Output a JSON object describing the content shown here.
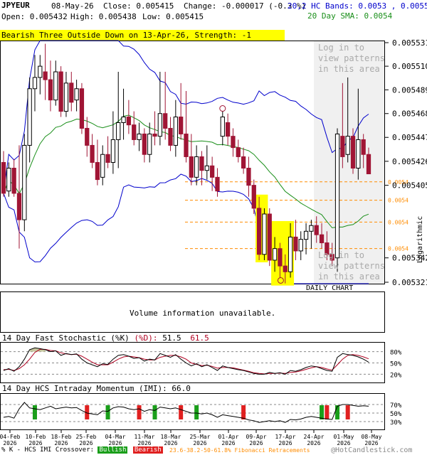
{
  "header": {
    "symbol": "JPYEUR",
    "date": "08-May-26",
    "close": "Close: 0.005415",
    "change": "Change: -0.000017 (-0.3 %)",
    "open": "Open: 0.005432",
    "high": "High: 0.005438",
    "low": "Low: 0.005415",
    "bands": "20,2 HC Bands: 0.0053 , 0.0055",
    "sma": "20 Day SMA: 0.0054",
    "pattern": "Bearish Three Outside Down on 13-Apr-26, Strength: -1"
  },
  "login_text": {
    "top_1": "Log in to",
    "top_2": "view patterns",
    "top_3": "in this area",
    "bottom_1": "Log in to",
    "bottom_2": "view patterns",
    "bottom_3": "in this area"
  },
  "price_axis_labels": [
    "0.005531",
    "0.005510",
    "0.005489",
    "0.005468",
    "0.005447",
    "0.005426",
    "0.005405",
    "0.005342",
    "0.005321"
  ],
  "fib_labels": [
    "0.0054",
    "0.0054",
    "0.0054",
    "0.0054"
  ],
  "logarithmic": "Logarithmic",
  "daily_chart": "DAILY CHART",
  "volume_text": "Volume information unavailable.",
  "stoch": {
    "title": "14 Day Fast Stochastic (%K)",
    "d_label": "(%D):",
    "k_value": "51.5",
    "d_value": "61.5",
    "levels": [
      "80%",
      "50%",
      "20%"
    ]
  },
  "imi": {
    "title": "14 Day HCS Intraday Momentum (IMI): 66.0",
    "levels": [
      "70%",
      "50%",
      "30%"
    ]
  },
  "date_labels": [
    {
      "top": "04-Feb",
      "bottom": "2026"
    },
    {
      "top": "10-Feb",
      "bottom": "2026"
    },
    {
      "top": "18-Feb",
      "bottom": "2026"
    },
    {
      "top": "25-Feb",
      "bottom": "2026"
    },
    {
      "top": "04-Mar",
      "bottom": "2026"
    },
    {
      "top": "11-Mar",
      "bottom": "2026"
    },
    {
      "top": "18-Mar",
      "bottom": "2026"
    },
    {
      "top": "25-Mar",
      "bottom": "2026"
    },
    {
      "top": "01-Apr",
      "bottom": "2026"
    },
    {
      "top": "09-Apr",
      "bottom": "2026"
    },
    {
      "top": "17-Apr",
      "bottom": "2026"
    },
    {
      "top": "24-Apr",
      "bottom": "2026"
    },
    {
      "top": "01-May",
      "bottom": "2026"
    },
    {
      "top": "08-May",
      "bottom": "2026"
    }
  ],
  "footer": {
    "prefix": "% K - HCS IMI Crossover:",
    "bullish": "Bullish",
    "bearish": "Bearish",
    "fib": "23.6-38.2-50-61.8% Fibonacci Retracements",
    "copyright": "@HotCandlestick.com"
  },
  "colors": {
    "bull": "#000000",
    "bear": "#a01535",
    "upper_band": "#0000cc",
    "sma": "#1a8f1a",
    "fib": "#ff8c00",
    "stoch_k": "#000000",
    "stoch_d": "#b00020",
    "highlight": "#ffff00",
    "pattern_bg": "#ffff00",
    "login_bg": "#f0f0f0",
    "login_text": "#aaaaaa",
    "imi_bull": "#1a9e1a",
    "imi_bear": "#e02020"
  },
  "chart_data": {
    "type": "candlestick",
    "y_scale": "logarithmic",
    "ylim": [
      0.005321,
      0.005531
    ],
    "candles": [
      {
        "o": 0.005425,
        "h": 0.005435,
        "l": 0.005395,
        "c": 0.005398
      },
      {
        "o": 0.0054,
        "h": 0.005425,
        "l": 0.005395,
        "c": 0.00542
      },
      {
        "o": 0.00542,
        "h": 0.005428,
        "l": 0.005395,
        "c": 0.005398
      },
      {
        "o": 0.005398,
        "h": 0.00544,
        "l": 0.00535,
        "c": 0.005375
      },
      {
        "o": 0.005375,
        "h": 0.00545,
        "l": 0.005365,
        "c": 0.00544
      },
      {
        "o": 0.00544,
        "h": 0.0055,
        "l": 0.005425,
        "c": 0.00549
      },
      {
        "o": 0.00549,
        "h": 0.00552,
        "l": 0.00547,
        "c": 0.0055
      },
      {
        "o": 0.0055,
        "h": 0.00552,
        "l": 0.005485,
        "c": 0.00551
      },
      {
        "o": 0.005505,
        "h": 0.00553,
        "l": 0.00548,
        "c": 0.005498
      },
      {
        "o": 0.005498,
        "h": 0.005515,
        "l": 0.00547,
        "c": 0.00548
      },
      {
        "o": 0.00548,
        "h": 0.005515,
        "l": 0.005475,
        "c": 0.005505
      },
      {
        "o": 0.005505,
        "h": 0.00551,
        "l": 0.005465,
        "c": 0.00547
      },
      {
        "o": 0.00547,
        "h": 0.005505,
        "l": 0.005465,
        "c": 0.005495
      },
      {
        "o": 0.005495,
        "h": 0.005505,
        "l": 0.00547,
        "c": 0.005478
      },
      {
        "o": 0.00548,
        "h": 0.005498,
        "l": 0.00547,
        "c": 0.00549
      },
      {
        "o": 0.00549,
        "h": 0.005495,
        "l": 0.00545,
        "c": 0.005455
      },
      {
        "o": 0.005455,
        "h": 0.005465,
        "l": 0.00543,
        "c": 0.00544
      },
      {
        "o": 0.00544,
        "h": 0.00545,
        "l": 0.00542,
        "c": 0.005425
      },
      {
        "o": 0.005425,
        "h": 0.005445,
        "l": 0.005405,
        "c": 0.00541
      },
      {
        "o": 0.005412,
        "h": 0.00544,
        "l": 0.005405,
        "c": 0.005432
      },
      {
        "o": 0.005432,
        "h": 0.005448,
        "l": 0.00542,
        "c": 0.005425
      },
      {
        "o": 0.005425,
        "h": 0.00547,
        "l": 0.005415,
        "c": 0.005445
      },
      {
        "o": 0.005445,
        "h": 0.005505,
        "l": 0.00542,
        "c": 0.00546
      },
      {
        "o": 0.00546,
        "h": 0.00549,
        "l": 0.005445,
        "c": 0.005465
      },
      {
        "o": 0.005465,
        "h": 0.00548,
        "l": 0.00545,
        "c": 0.005458
      },
      {
        "o": 0.005458,
        "h": 0.00547,
        "l": 0.00544,
        "c": 0.005445
      },
      {
        "o": 0.005445,
        "h": 0.00546,
        "l": 0.005435,
        "c": 0.00545
      },
      {
        "o": 0.00545,
        "h": 0.005455,
        "l": 0.005425,
        "c": 0.005432
      },
      {
        "o": 0.005432,
        "h": 0.00546,
        "l": 0.005425,
        "c": 0.00545
      },
      {
        "o": 0.00545,
        "h": 0.00547,
        "l": 0.00544,
        "c": 0.005448
      },
      {
        "o": 0.005448,
        "h": 0.005505,
        "l": 0.00544,
        "c": 0.005468
      },
      {
        "o": 0.005468,
        "h": 0.005505,
        "l": 0.005445,
        "c": 0.005455
      },
      {
        "o": 0.005455,
        "h": 0.005465,
        "l": 0.005435,
        "c": 0.00544
      },
      {
        "o": 0.00544,
        "h": 0.00548,
        "l": 0.00543,
        "c": 0.005465
      },
      {
        "o": 0.005465,
        "h": 0.005495,
        "l": 0.005445,
        "c": 0.00545
      },
      {
        "o": 0.00545,
        "h": 0.005488,
        "l": 0.005425,
        "c": 0.00543
      },
      {
        "o": 0.00543,
        "h": 0.00545,
        "l": 0.005405,
        "c": 0.005412
      },
      {
        "o": 0.005412,
        "h": 0.00544,
        "l": 0.005405,
        "c": 0.00543
      },
      {
        "o": 0.00543,
        "h": 0.005435,
        "l": 0.005405,
        "c": 0.005418
      },
      {
        "o": 0.005418,
        "h": 0.00544,
        "l": 0.00541,
        "c": 0.005422
      },
      {
        "o": 0.005422,
        "h": 0.00543,
        "l": 0.0054,
        "c": 0.005412
      },
      {
        "o": 0.005412,
        "h": 0.00542,
        "l": 0.005395,
        "c": 0.0054
      },
      {
        "o": 0.005448,
        "h": 0.00547,
        "l": 0.00544,
        "c": 0.005465
      },
      {
        "o": 0.00546,
        "h": 0.005468,
        "l": 0.00544,
        "c": 0.005448
      },
      {
        "o": 0.005448,
        "h": 0.005455,
        "l": 0.00543,
        "c": 0.005438
      },
      {
        "o": 0.005438,
        "h": 0.005445,
        "l": 0.005425,
        "c": 0.00543
      },
      {
        "o": 0.00543,
        "h": 0.005438,
        "l": 0.005415,
        "c": 0.00542
      },
      {
        "o": 0.00542,
        "h": 0.00543,
        "l": 0.005395,
        "c": 0.005405
      },
      {
        "o": 0.005405,
        "h": 0.00541,
        "l": 0.00538,
        "c": 0.005385
      },
      {
        "o": 0.005385,
        "h": 0.005395,
        "l": 0.00534,
        "c": 0.005345
      },
      {
        "o": 0.005345,
        "h": 0.005385,
        "l": 0.00534,
        "c": 0.00538
      },
      {
        "o": 0.00538,
        "h": 0.005385,
        "l": 0.005335,
        "c": 0.00534
      },
      {
        "o": 0.00534,
        "h": 0.00536,
        "l": 0.00533,
        "c": 0.00535
      },
      {
        "o": 0.00535,
        "h": 0.005355,
        "l": 0.005325,
        "c": 0.005335
      },
      {
        "o": 0.005335,
        "h": 0.005345,
        "l": 0.00532,
        "c": 0.00533
      },
      {
        "o": 0.00533,
        "h": 0.005372,
        "l": 0.005325,
        "c": 0.00536
      },
      {
        "o": 0.00536,
        "h": 0.005375,
        "l": 0.00534,
        "c": 0.005348
      },
      {
        "o": 0.005348,
        "h": 0.005365,
        "l": 0.00534,
        "c": 0.005358
      },
      {
        "o": 0.005358,
        "h": 0.005372,
        "l": 0.005345,
        "c": 0.005365
      },
      {
        "o": 0.005365,
        "h": 0.005375,
        "l": 0.00535,
        "c": 0.00537
      },
      {
        "o": 0.00537,
        "h": 0.005378,
        "l": 0.005355,
        "c": 0.005362
      },
      {
        "o": 0.005362,
        "h": 0.005372,
        "l": 0.00535,
        "c": 0.005355
      },
      {
        "o": 0.005355,
        "h": 0.005365,
        "l": 0.00534,
        "c": 0.005345
      },
      {
        "o": 0.005345,
        "h": 0.005355,
        "l": 0.005335,
        "c": 0.00534
      },
      {
        "o": 0.005342,
        "h": 0.005455,
        "l": 0.00533,
        "c": 0.00545
      },
      {
        "o": 0.005448,
        "h": 0.005495,
        "l": 0.00542,
        "c": 0.00543
      },
      {
        "o": 0.005432,
        "h": 0.0055,
        "l": 0.005425,
        "c": 0.005448
      },
      {
        "o": 0.005448,
        "h": 0.005455,
        "l": 0.005415,
        "c": 0.00542
      },
      {
        "o": 0.00542,
        "h": 0.00549,
        "l": 0.00541,
        "c": 0.005445
      },
      {
        "o": 0.005445,
        "h": 0.00545,
        "l": 0.00542,
        "c": 0.005432
      },
      {
        "o": 0.005432,
        "h": 0.005438,
        "l": 0.005415,
        "c": 0.005415
      }
    ],
    "stoch_k": [
      30,
      35,
      28,
      40,
      60,
      85,
      90,
      88,
      85,
      80,
      82,
      70,
      75,
      72,
      74,
      60,
      50,
      45,
      40,
      48,
      46,
      60,
      70,
      72,
      68,
      62,
      64,
      55,
      60,
      58,
      75,
      70,
      65,
      72,
      60,
      50,
      42,
      48,
      40,
      45,
      38,
      30,
      42,
      38,
      35,
      32,
      30,
      26,
      22,
      20,
      20,
      25,
      22,
      24,
      20,
      30,
      28,
      32,
      38,
      42,
      40,
      35,
      30,
      28,
      65,
      75,
      72,
      70,
      66,
      60,
      52
    ],
    "stoch_d": [
      32,
      33,
      30,
      35,
      45,
      60,
      78,
      86,
      86,
      83,
      82,
      77,
      74,
      72,
      73,
      68,
      60,
      52,
      45,
      45,
      45,
      52,
      60,
      66,
      68,
      66,
      64,
      60,
      58,
      58,
      65,
      68,
      70,
      70,
      66,
      60,
      50,
      46,
      43,
      44,
      41,
      36,
      38,
      38,
      37,
      34,
      31,
      28,
      24,
      22,
      21,
      22,
      22,
      23,
      22,
      25,
      26,
      29,
      33,
      37,
      40,
      38,
      34,
      31,
      45,
      60,
      70,
      72,
      70,
      66,
      61
    ],
    "imi": [
      40,
      42,
      38,
      60,
      75,
      62,
      60,
      58,
      62,
      66,
      60,
      62,
      64,
      62,
      63,
      56,
      50,
      48,
      46,
      55,
      54,
      62,
      65,
      64,
      60,
      58,
      60,
      54,
      58,
      56,
      64,
      62,
      60,
      62,
      58,
      54,
      50,
      50,
      48,
      50,
      46,
      40,
      46,
      44,
      42,
      40,
      38,
      34,
      32,
      28,
      30,
      32,
      30,
      32,
      28,
      35,
      34,
      36,
      40,
      42,
      40,
      38,
      36,
      35,
      66,
      70,
      70,
      68,
      66,
      67,
      66
    ]
  }
}
